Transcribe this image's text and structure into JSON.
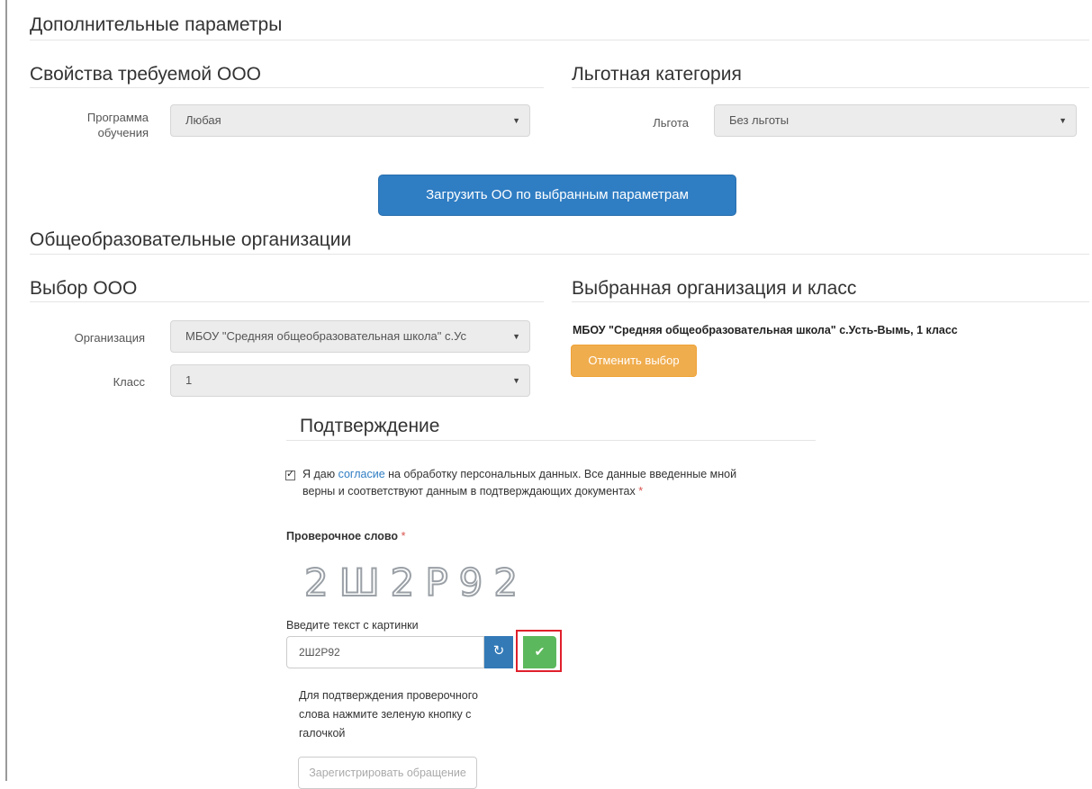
{
  "sections": {
    "additional_params": "Дополнительные параметры",
    "required_org_props": "Свойства требуемой ООО",
    "benefit_category": "Льготная категория",
    "orgs": "Общеобразовательные организации",
    "choose_org": "Выбор ООО",
    "chosen_org_class": "Выбранная организация и класс",
    "confirmation": "Подтверждение"
  },
  "filters": {
    "program_label_line1": "Программа",
    "program_label_line2": "обучения",
    "program_value": "Любая",
    "benefit_label": "Льгота",
    "benefit_value": "Без льготы",
    "load_button": "Загрузить ОО по выбранным параметрам"
  },
  "selection": {
    "org_label": "Организация",
    "org_value": "МБОУ \"Средняя общеобразовательная школа\" с.Ус",
    "class_label": "Класс",
    "class_value": "1",
    "selected_text": "МБОУ \"Средняя общеобразовательная школа\" с.Усть-Вымь, 1 класс",
    "cancel_button": "Отменить выбор"
  },
  "confirm": {
    "consent_prefix": "Я даю ",
    "consent_link": "согласие",
    "consent_suffix": " на обработку персональных данных. Все данные введенные мной",
    "consent_line2": "верны и соответствуют данным в подтверждающих документах",
    "required_mark": "*",
    "captcha_label": "Проверочное слово",
    "captcha_image_text": "2Ш2Р92",
    "input_label": "Введите текст с картинки",
    "input_value": "2Ш2Р92",
    "hint_line1": "Для подтверждения проверочного",
    "hint_line2": "слова нажмите зеленую кнопку с",
    "hint_line3": "галочкой",
    "register_button": "Зарегистрировать обращение"
  },
  "icons": {
    "caret": "▼",
    "refresh": "↻",
    "check": "✔",
    "checkbox": "✓"
  },
  "colors": {
    "primary": "#2f7dc3",
    "warning": "#f0ad4e",
    "success": "#5cb85c",
    "highlight": "#e0202b"
  }
}
